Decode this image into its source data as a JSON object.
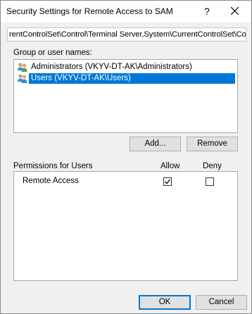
{
  "window": {
    "title": "Security Settings for Remote Access to SAM",
    "help_glyph": "?",
    "close_icon": "close-icon"
  },
  "path_field": {
    "value": "rentControlSet\\Control\\Terminal Server,System\\CurrentControlSet\\Contro"
  },
  "groups": {
    "label": "Group or user names:",
    "items": [
      {
        "label": "Administrators (VKYV-DT-AK\\Administrators)",
        "icon": "users-group-icon",
        "selected": false
      },
      {
        "label": "Users (VKYV-DT-AK\\Users)",
        "icon": "users-group-icon",
        "selected": true
      }
    ],
    "add_label": "Add...",
    "remove_label": "Remove"
  },
  "permissions": {
    "header_label": "Permissions for Users",
    "allow_label": "Allow",
    "deny_label": "Deny",
    "rows": [
      {
        "name": "Remote Access",
        "allow": true,
        "deny": false
      }
    ]
  },
  "footer": {
    "ok_label": "OK",
    "cancel_label": "Cancel"
  },
  "colors": {
    "selection": "#0078d7",
    "dialog_bg": "#f0f0f0",
    "button_bg": "#e1e1e1"
  }
}
